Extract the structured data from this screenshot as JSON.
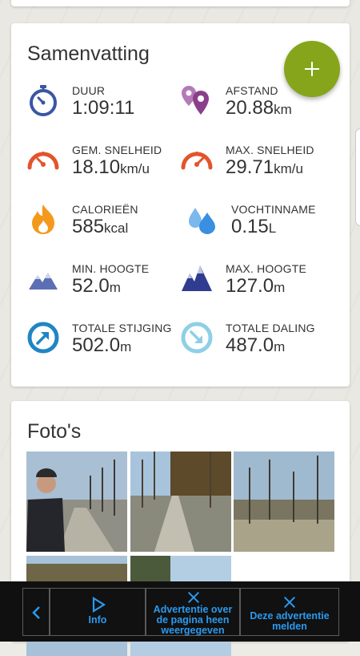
{
  "summary": {
    "title": "Samenvatting",
    "fab_icon": "plus-icon",
    "stats": [
      {
        "label": "DUUR",
        "value": "1:09:11",
        "unit": "",
        "icon": "stopwatch-icon",
        "color": "#3a56a4"
      },
      {
        "label": "AFSTAND",
        "value": "20.88",
        "unit": "km",
        "icon": "map-pins-icon",
        "color": "#8a3f8c"
      },
      {
        "label": "GEM. SNELHEID",
        "value": "18.10",
        "unit": "km/u",
        "icon": "speedometer-icon",
        "color": "#e4532b"
      },
      {
        "label": "MAX. SNELHEID",
        "value": "29.71",
        "unit": "km/u",
        "icon": "speedometer-max-icon",
        "color": "#e4532b"
      },
      {
        "label": "CALORIEËN",
        "value": "585",
        "unit": "kcal",
        "icon": "flame-icon",
        "color": "#f39a1e"
      },
      {
        "label": "VOCHTINNAME",
        "value": "0.15",
        "unit": "L",
        "icon": "water-drops-icon",
        "color": "#3a8fe0"
      },
      {
        "label": "MIN. HOOGTE",
        "value": "52.0",
        "unit": "m",
        "icon": "mountain-low-icon",
        "color": "#5c6fb5"
      },
      {
        "label": "MAX. HOOGTE",
        "value": "127.0",
        "unit": "m",
        "icon": "mountain-high-icon",
        "color": "#2f3c8f"
      },
      {
        "label": "TOTALE STIJGING",
        "value": "502.0",
        "unit": "m",
        "icon": "ascent-arrow-icon",
        "color": "#1f86c4"
      },
      {
        "label": "TOTALE DALING",
        "value": "487.0",
        "unit": "m",
        "icon": "descent-arrow-icon",
        "color": "#8dd0e6"
      }
    ]
  },
  "photos": {
    "title": "Foto's"
  },
  "adbar": {
    "back_icon": "chevron-left-icon",
    "info_label": "Info",
    "about_label_1": "Advertentie over",
    "about_label_2": "de pagina heen",
    "about_label_3": "weergegeven",
    "report_label_1": "Deze advertentie",
    "report_label_2": "melden",
    "accent": "#2a9af0"
  }
}
